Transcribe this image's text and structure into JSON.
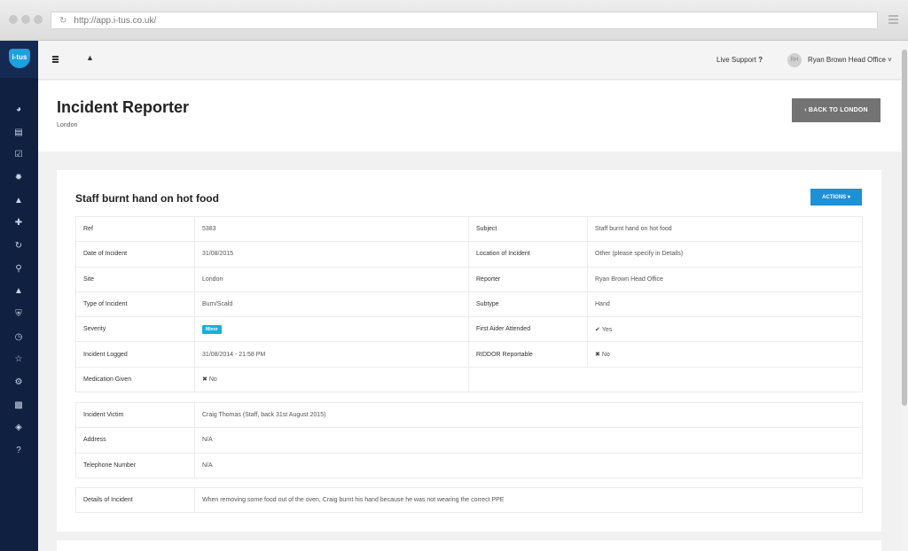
{
  "browser": {
    "url": "http://app.i-tus.co.uk/",
    "reload_icon": "reload-icon"
  },
  "sidebar": {
    "logo_text": "i-tus",
    "icons": [
      "dashboard-icon",
      "document-icon",
      "checklist-icon",
      "bug-icon",
      "thumbs-up-icon",
      "first-aid-icon",
      "refresh-icon",
      "search-icon",
      "graduation-cap-icon",
      "shield-icon",
      "clock-icon",
      "trophy-icon",
      "gear-icon",
      "bar-chart-icon",
      "globe-icon",
      "help-icon"
    ]
  },
  "topbar": {
    "live_support": "Live Support",
    "live_support_mark": "?",
    "avatar_initials": "RH",
    "user_name": "Ryan Brown Head Office ˅"
  },
  "header": {
    "title": "Incident Reporter",
    "subtitle": "London",
    "back_button": "‹ BACK TO LONDON"
  },
  "incident": {
    "title": "Staff burnt hand on hot food",
    "actions_button": "ACTIONS ▾",
    "fields": {
      "ref_label": "Ref",
      "ref_value": "5383",
      "subject_label": "Subject",
      "subject_value": "Staff burnt hand on hot food",
      "date_label": "Date of Incident",
      "date_value": "31/08/2015",
      "location_label": "Location of Incident",
      "location_value": "Other (please specify in Details)",
      "site_label": "Site",
      "site_value": "London",
      "reporter_label": "Reporter",
      "reporter_value": "Ryan Brown Head Office",
      "type_label": "Type of Incident",
      "type_value": "Burn/Scald",
      "subtype_label": "Subtype",
      "subtype_value": "Hand",
      "severity_label": "Severity",
      "severity_value": "Minor",
      "first_aider_label": "First Aider Attended",
      "first_aider_value": "Yes",
      "logged_label": "Incident Logged",
      "logged_value": "31/08/2014 - 21:58 PM",
      "riddor_label": "RIDDOR Reportable",
      "riddor_value": "No",
      "medication_label": "Medication Given",
      "medication_value": "No"
    },
    "victim": {
      "victim_label": "Incident Victim",
      "victim_value": "Craig Thomas (Staff, back 31st August 2015)",
      "address_label": "Address",
      "address_value": "N/A",
      "phone_label": "Telephone Number",
      "phone_value": "N/A"
    },
    "details": {
      "label": "Details of Incident",
      "value": "When removing some food out of the oven, Craig burnt his hand because he was not wearing the correct PPE"
    }
  },
  "colors": {
    "sidebar": "#0f2040",
    "accent": "#1a91d9",
    "badge": "#17b0e0",
    "back_button": "#737373"
  }
}
